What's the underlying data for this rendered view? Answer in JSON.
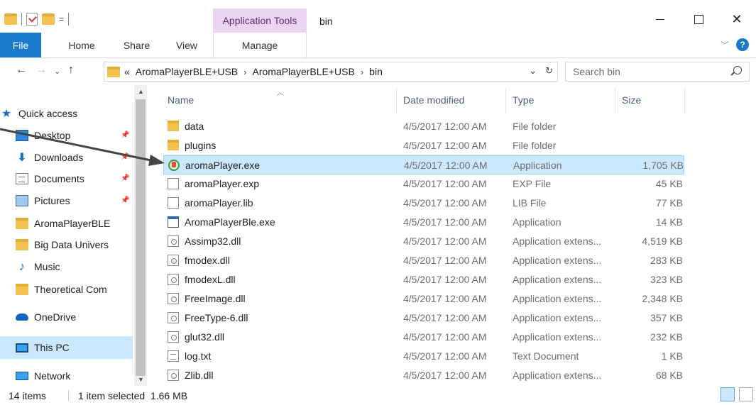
{
  "titlebar": {
    "context_tab": "Application Tools",
    "window_title": "bin",
    "qat_dropdown": "="
  },
  "ribbon": {
    "tabs": {
      "file": "File",
      "home": "Home",
      "share": "Share",
      "view": "View",
      "manage": "Manage"
    },
    "help": "?"
  },
  "address": {
    "overflow": "«",
    "crumbs": [
      "AromaPlayerBLE+USB",
      "AromaPlayerBLE+USB",
      "bin"
    ],
    "separator": "›",
    "search_placeholder": "Search bin"
  },
  "nav": {
    "items": [
      {
        "label": "Quick access",
        "icon": "star-icon"
      },
      {
        "label": "Desktop",
        "icon": "desktop-icon",
        "pinned": true
      },
      {
        "label": "Downloads",
        "icon": "download-icon",
        "pinned": true
      },
      {
        "label": "Documents",
        "icon": "document-icon",
        "pinned": true
      },
      {
        "label": "Pictures",
        "icon": "pictures-icon",
        "pinned": true
      },
      {
        "label": "AromaPlayerBLE",
        "icon": "folder-icon"
      },
      {
        "label": "Big Data Univers",
        "icon": "folder-icon"
      },
      {
        "label": "Music",
        "icon": "music-icon"
      },
      {
        "label": "Theoretical Com",
        "icon": "folder-icon"
      },
      {
        "label": "OneDrive",
        "icon": "cloud-icon"
      },
      {
        "label": "This PC",
        "icon": "computer-icon",
        "selected": true
      },
      {
        "label": "Network",
        "icon": "network-icon"
      }
    ]
  },
  "columns": {
    "name": "Name",
    "date": "Date modified",
    "type": "Type",
    "size": "Size"
  },
  "files": [
    {
      "name": "data",
      "date": "4/5/2017 12:00 AM",
      "type": "File folder",
      "size": "",
      "icon": "folder-icon"
    },
    {
      "name": "plugins",
      "date": "4/5/2017 12:00 AM",
      "type": "File folder",
      "size": "",
      "icon": "folder-icon"
    },
    {
      "name": "aromaPlayer.exe",
      "date": "4/5/2017 12:00 AM",
      "type": "Application",
      "size": "1,705 KB",
      "icon": "exe-icon",
      "selected": true
    },
    {
      "name": "aromaPlayer.exp",
      "date": "4/5/2017 12:00 AM",
      "type": "EXP File",
      "size": "45 KB",
      "icon": "file-icon"
    },
    {
      "name": "aromaPlayer.lib",
      "date": "4/5/2017 12:00 AM",
      "type": "LIB File",
      "size": "77 KB",
      "icon": "file-icon"
    },
    {
      "name": "AromaPlayerBle.exe",
      "date": "4/5/2017 12:00 AM",
      "type": "Application",
      "size": "14 KB",
      "icon": "app-icon"
    },
    {
      "name": "Assimp32.dll",
      "date": "4/5/2017 12:00 AM",
      "type": "Application extens...",
      "size": "4,519 KB",
      "icon": "dll-icon"
    },
    {
      "name": "fmodex.dll",
      "date": "4/5/2017 12:00 AM",
      "type": "Application extens...",
      "size": "283 KB",
      "icon": "dll-icon"
    },
    {
      "name": "fmodexL.dll",
      "date": "4/5/2017 12:00 AM",
      "type": "Application extens...",
      "size": "323 KB",
      "icon": "dll-icon"
    },
    {
      "name": "FreeImage.dll",
      "date": "4/5/2017 12:00 AM",
      "type": "Application extens...",
      "size": "2,348 KB",
      "icon": "dll-icon"
    },
    {
      "name": "FreeType-6.dll",
      "date": "4/5/2017 12:00 AM",
      "type": "Application extens...",
      "size": "357 KB",
      "icon": "dll-icon"
    },
    {
      "name": "glut32.dll",
      "date": "4/5/2017 12:00 AM",
      "type": "Application extens...",
      "size": "232 KB",
      "icon": "dll-icon"
    },
    {
      "name": "log.txt",
      "date": "4/5/2017 12:00 AM",
      "type": "Text Document",
      "size": "1 KB",
      "icon": "text-file-icon"
    },
    {
      "name": "Zlib.dll",
      "date": "4/5/2017 12:00 AM",
      "type": "Application extens...",
      "size": "68 KB",
      "icon": "dll-icon"
    }
  ],
  "status": {
    "count": "14 items",
    "selection": "1 item selected  1.66 MB"
  },
  "colors": {
    "accent": "#1979ca",
    "selection": "#cce8ff",
    "context_tab": "#ebd5f3"
  }
}
